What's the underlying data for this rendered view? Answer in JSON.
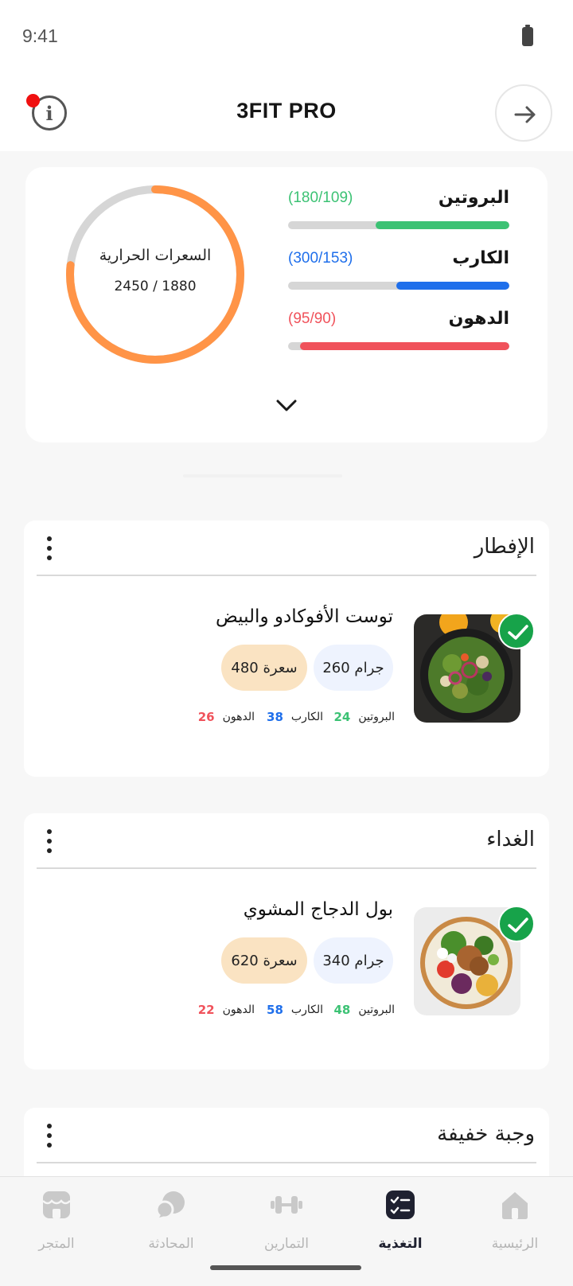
{
  "status": {
    "time": "9:41"
  },
  "header": {
    "title": "3FIT PRO"
  },
  "summary": {
    "calories_label": "السعرات الحرارية",
    "calories_value": "2450 / 1880",
    "calories_consumed": 1880,
    "calories_goal": 2450,
    "ring_color": "#FF9447",
    "macros": [
      {
        "name": "البروتين",
        "ratio": "(180/109)",
        "consumed": 109,
        "goal": 180,
        "color": "#3CC274"
      },
      {
        "name": "الكارب",
        "ratio": "(300/153)",
        "consumed": 153,
        "goal": 300,
        "color": "#1F6FEB"
      },
      {
        "name": "الدهون",
        "ratio": "(95/90)",
        "consumed": 90,
        "goal": 95,
        "color": "#F0525B"
      }
    ]
  },
  "meals": [
    {
      "title": "الإفطار",
      "food_name": "توست الأفوكادو والبيض",
      "grams": "260 جرام",
      "calories": "480 سعرة",
      "protein_label": "البروتين",
      "protein": "24",
      "carb_label": "الكارب",
      "carb": "38",
      "fat_label": "الدهون",
      "fat": "26",
      "done": true
    },
    {
      "title": "الغداء",
      "food_name": "بول الدجاج المشوي",
      "grams": "340 جرام",
      "calories": "620 سعرة",
      "protein_label": "البروتين",
      "protein": "48",
      "carb_label": "الكارب",
      "carb": "58",
      "fat_label": "الدهون",
      "fat": "22",
      "done": true
    },
    {
      "title": "وجبة خفيفة"
    }
  ],
  "nav": [
    {
      "label": "الرئيسية",
      "icon": "home-icon"
    },
    {
      "label": "التغذية",
      "icon": "nutrition-icon",
      "active": true
    },
    {
      "label": "التمارين",
      "icon": "dumbbell-icon"
    },
    {
      "label": "المحادثة",
      "icon": "chat-icon"
    },
    {
      "label": "المتجر",
      "icon": "store-icon"
    }
  ],
  "colors": {
    "protein": "#3CC274",
    "carb": "#1F6FEB",
    "fat": "#F0525B",
    "check": "#17A34A",
    "calorie_pill": "#FAE3C2",
    "gram_pill": "#EEF3FE"
  }
}
